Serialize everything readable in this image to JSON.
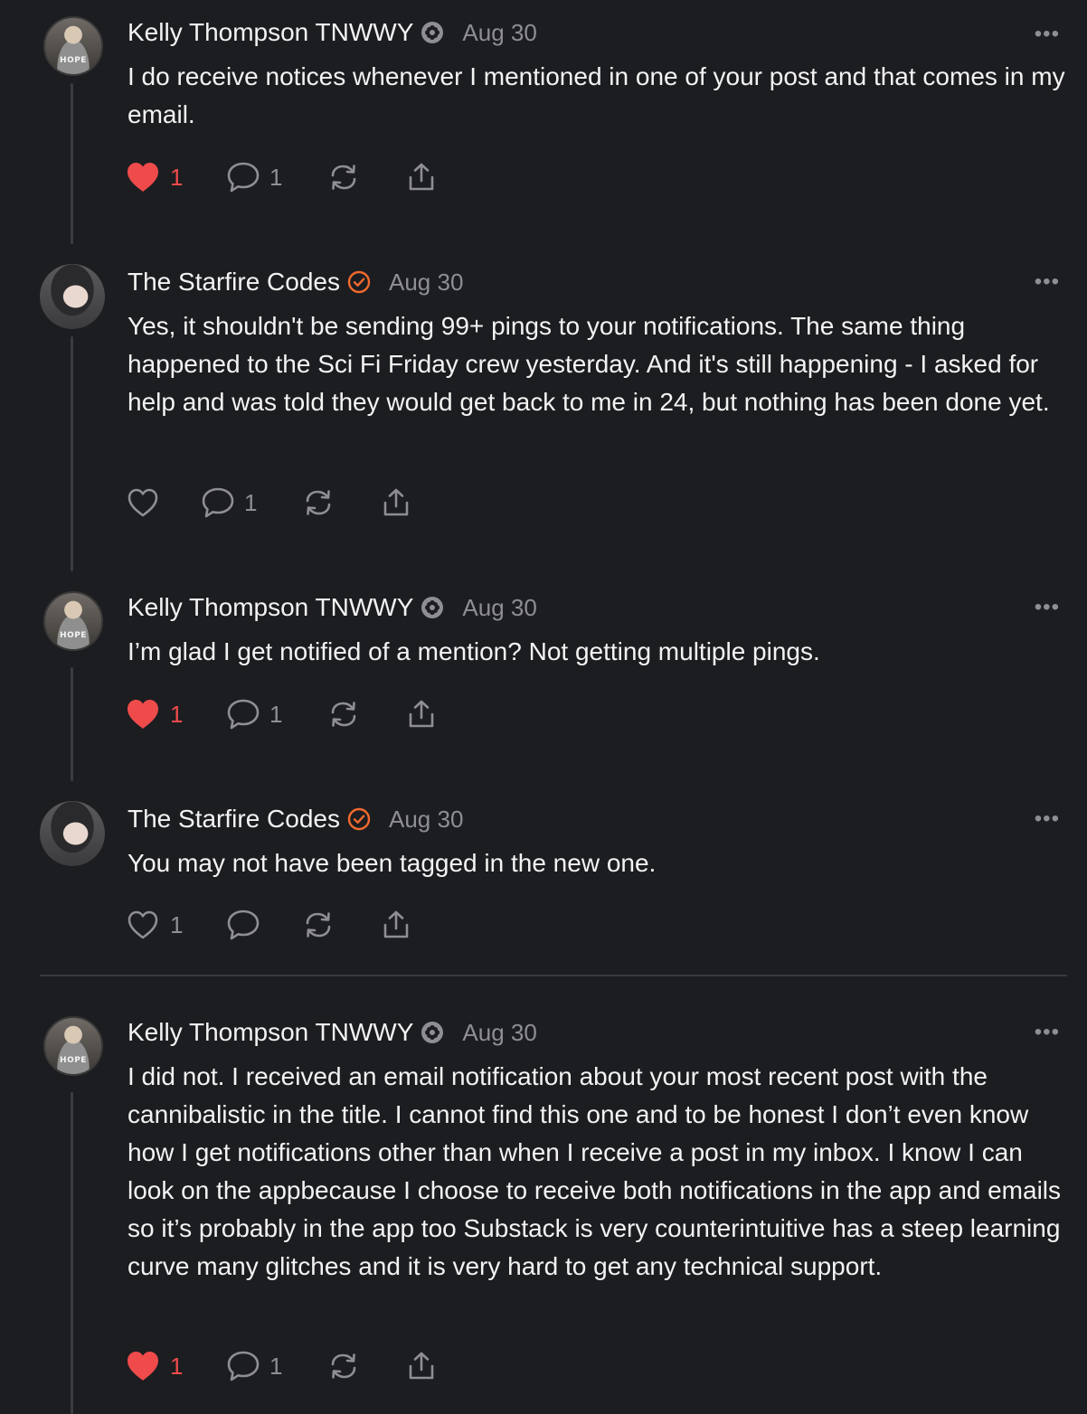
{
  "comments": [
    {
      "author": "Kelly Thompson TNWWY",
      "date": "Aug 30",
      "more": "•••",
      "avatar_text": "HOPE",
      "text": "I do receive notices whenever I mentioned in one of your post and that comes in my email.",
      "likes": "1",
      "liked": true,
      "replies": "1"
    },
    {
      "author": "The Starfire Codes",
      "date": "Aug 30",
      "more": "•••",
      "text": "Yes, it shouldn't be sending 99+ pings to your notifications. The same thing happened to the Sci Fi Friday crew yesterday. And it's still happening - I asked for help and was told they would get back to me in 24, but nothing has been done yet.",
      "likes": "",
      "liked": false,
      "replies": "1"
    },
    {
      "author": "Kelly Thompson TNWWY",
      "date": "Aug 30",
      "more": "•••",
      "avatar_text": "HOPE",
      "text": "I’m glad I get notified of a mention? Not getting multiple pings.",
      "likes": "1",
      "liked": true,
      "replies": "1"
    },
    {
      "author": "The Starfire Codes",
      "date": "Aug 30",
      "more": "•••",
      "text": "You may not have been tagged in the new one.",
      "likes": "1",
      "liked": false,
      "replies": ""
    },
    {
      "author": "Kelly Thompson TNWWY",
      "date": "Aug 30",
      "more": "•••",
      "avatar_text": "HOPE",
      "text": "I did not. I received an email notification about your most recent post with the cannibalistic in the title. I cannot find this one and to be honest I don’t even know how I get notifications other than when I receive a post in my inbox. I know I can look on the appbecause I choose to receive both notifications in the app and emails so it’s probably in the app too Substack is very counterintuitive has a steep learning curve many glitches and it is very hard to get any technical support.",
      "likes": "1",
      "liked": true,
      "replies": "1"
    }
  ],
  "colors": {
    "background": "#1c1d20",
    "like_active": "#ef4b4b",
    "verified_badge": "#f26a2e",
    "muted": "#8e8e93"
  },
  "icons": {
    "author_badge_kelly": "flower-badge-icon",
    "author_badge_starfire": "verified-check-icon",
    "like": "heart-icon",
    "reply": "speech-bubble-icon",
    "restack": "restack-icon",
    "share": "share-icon",
    "more": "more-dots-icon"
  }
}
